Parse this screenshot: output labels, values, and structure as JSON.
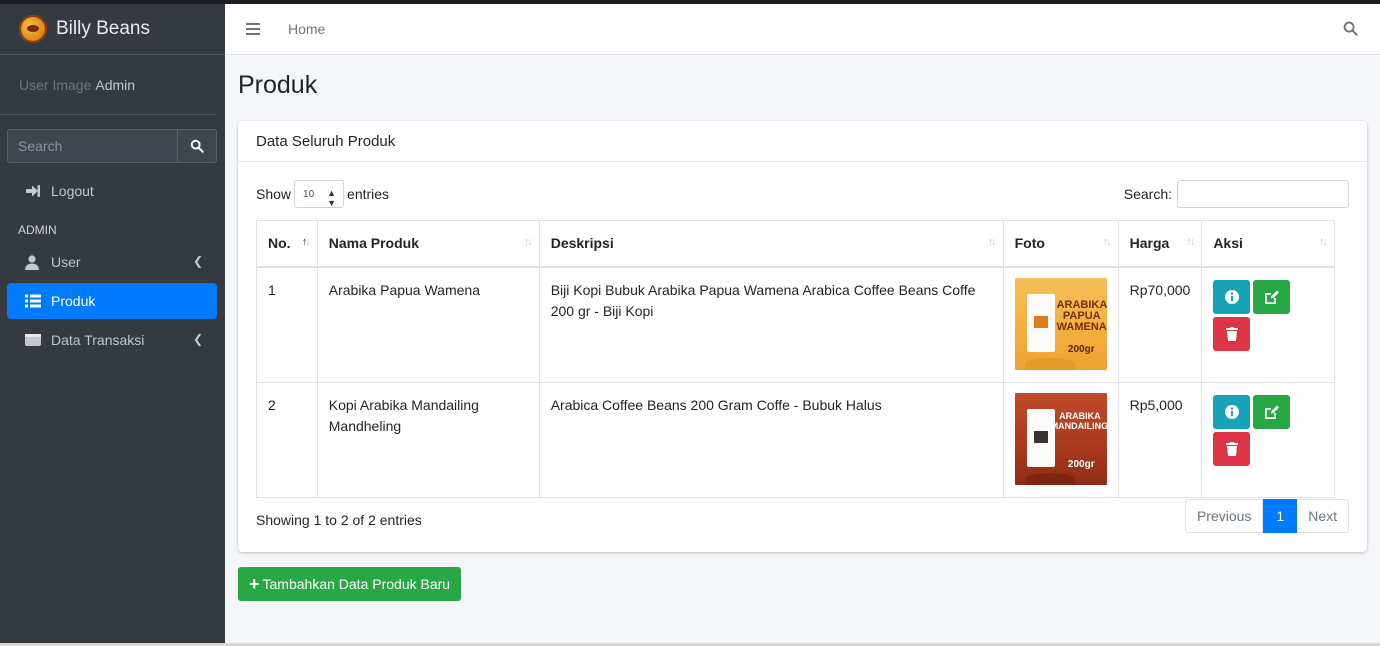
{
  "brand": {
    "name": "Billy Beans"
  },
  "user": {
    "image_alt": "User Image",
    "name": "Admin"
  },
  "sidebar": {
    "search_placeholder": "Search",
    "logout": "Logout",
    "header": "ADMIN",
    "items": [
      {
        "label": "User"
      },
      {
        "label": "Produk"
      },
      {
        "label": "Data Transaksi"
      }
    ]
  },
  "navbar": {
    "home": "Home"
  },
  "page": {
    "title": "Produk"
  },
  "card": {
    "title": "Data Seluruh Produk",
    "show": "Show",
    "entries_value": "10",
    "entries": "entries",
    "search_label": "Search:"
  },
  "table": {
    "columns": [
      "No.",
      "Nama Produk",
      "Deskripsi",
      "Foto",
      "Harga",
      "Aksi"
    ],
    "rows": [
      {
        "no": "1",
        "name": "Arabika Papua Wamena",
        "desc": "Biji Kopi Bubuk Arabika Papua Wamena Arabica Coffee Beans Coffe 200 gr - Biji Kopi",
        "photo_title": "ARABIKA PAPUA WAMENA",
        "photo_weight": "200gr",
        "price": "Rp70,000"
      },
      {
        "no": "2",
        "name": "Kopi Arabika Mandailing Mandheling",
        "desc": "Arabica Coffee Beans 200 Gram Coffe - Bubuk Halus",
        "photo_title": "ARABIKA MANDAILING",
        "photo_weight": "200gr",
        "price": "Rp5,000"
      }
    ]
  },
  "footer": {
    "info": "Showing 1 to 2 of 2 entries",
    "previous": "Previous",
    "page": "1",
    "next": "Next"
  },
  "add_button": "Tambahkan Data Produk Baru",
  "colors": {
    "primary": "#007bff",
    "success": "#28a745",
    "info": "#17a2b8",
    "danger": "#dc3545",
    "sidebar": "#343a40"
  }
}
